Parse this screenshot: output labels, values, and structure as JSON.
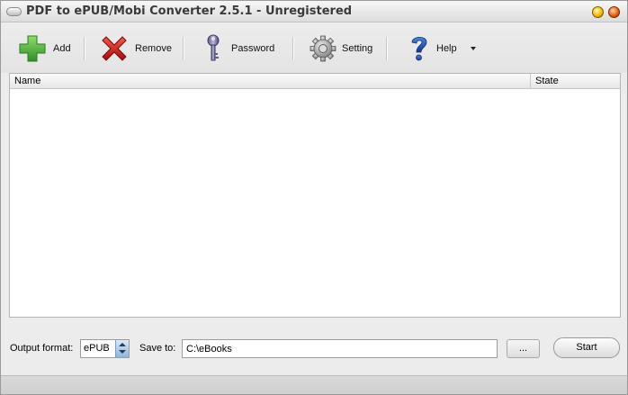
{
  "window": {
    "title": "PDF to ePUB/Mobi Converter 2.5.1 - Unregistered"
  },
  "toolbar": {
    "add_label": "Add",
    "remove_label": "Remove",
    "password_label": "Password",
    "setting_label": "Setting",
    "help_label": "Help",
    "icons": {
      "add": "plus-icon",
      "remove": "x-icon",
      "password": "key-icon",
      "setting": "gear-icon",
      "help": "question-mark-icon"
    },
    "colors": {
      "add": "#3fa93a",
      "remove": "#c8141c",
      "help": "#1d4fa8"
    }
  },
  "list": {
    "columns": [
      "Name",
      "State"
    ],
    "rows": []
  },
  "bottom": {
    "output_format_label": "Output format:",
    "output_format_value": "ePUB",
    "save_to_label": "Save to:",
    "save_to_value": "C:\\eBooks",
    "browse_label": "...",
    "start_label": "Start"
  }
}
